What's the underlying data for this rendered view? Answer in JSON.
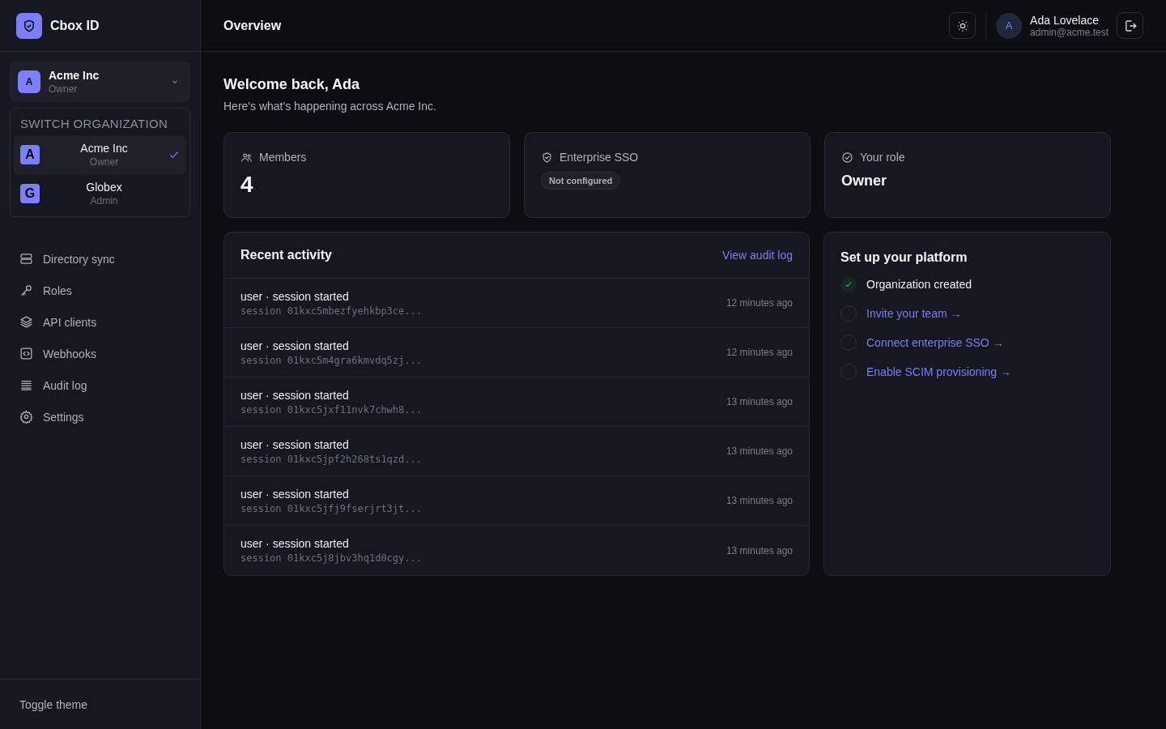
{
  "brand": {
    "name": "Cbox ID"
  },
  "org_switcher": {
    "avatar": "A",
    "name": "Acme Inc",
    "role": "Owner"
  },
  "org_menu": {
    "heading": "SWITCH ORGANIZATION",
    "items": [
      {
        "avatar": "A",
        "name": "Acme Inc",
        "role": "Owner",
        "selected": true
      },
      {
        "avatar": "G",
        "name": "Globex",
        "role": "Admin",
        "selected": false
      }
    ]
  },
  "sidebar": {
    "items": [
      {
        "label": "Directory sync"
      },
      {
        "label": "Roles"
      },
      {
        "label": "API clients"
      },
      {
        "label": "Webhooks"
      },
      {
        "label": "Audit log"
      },
      {
        "label": "Settings"
      }
    ],
    "footer": "Toggle theme"
  },
  "header": {
    "title": "Overview",
    "user": {
      "avatar": "A",
      "name": "Ada Lovelace",
      "email": "admin@acme.test"
    }
  },
  "welcome": {
    "title": "Welcome back, Ada",
    "subtitle": "Here's what's happening across Acme Inc."
  },
  "stats": [
    {
      "kind": "number",
      "label": "Members",
      "value": "4"
    },
    {
      "kind": "badge",
      "label": "Enterprise SSO",
      "value": "Not configured"
    },
    {
      "kind": "text",
      "label": "Your role",
      "value": "Owner"
    }
  ],
  "activity": {
    "title": "Recent activity",
    "link": "View audit log",
    "rows": [
      {
        "event": "user · session started",
        "detail": "session 01kxc5mbezfyehkbp3ce...",
        "time": "12 minutes ago"
      },
      {
        "event": "user · session started",
        "detail": "session 01kxc5m4gra6kmvdq5zj...",
        "time": "12 minutes ago"
      },
      {
        "event": "user · session started",
        "detail": "session 01kxc5jxf11nvk7chwh8...",
        "time": "13 minutes ago"
      },
      {
        "event": "user · session started",
        "detail": "session 01kxc5jpf2h268ts1qzd...",
        "time": "13 minutes ago"
      },
      {
        "event": "user · session started",
        "detail": "session 01kxc5jfj9fserjrt3jt...",
        "time": "13 minutes ago"
      },
      {
        "event": "user · session started",
        "detail": "session 01kxc5j8jbv3hq1d0cgy...",
        "time": "13 minutes ago"
      }
    ]
  },
  "setup": {
    "title": "Set up your platform",
    "items": [
      {
        "label": "Organization created",
        "done": true
      },
      {
        "label": "Invite your team →",
        "done": false
      },
      {
        "label": "Connect enterprise SSO →",
        "done": false
      },
      {
        "label": "Enable SCIM provisioning →",
        "done": false
      }
    ]
  }
}
